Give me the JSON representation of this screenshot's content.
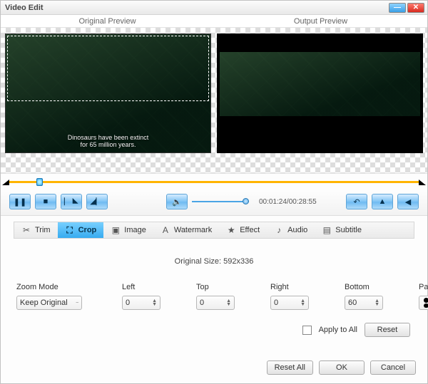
{
  "window": {
    "title": "Video Edit"
  },
  "previews": {
    "original_label": "Original Preview",
    "output_label": "Output Preview",
    "subtitle_line1": "Dinosaurs have been extinct",
    "subtitle_line2": "for 65 million years."
  },
  "timecode": "00:01:24/00:28:55",
  "tabs": [
    {
      "key": "trim",
      "label": "Trim",
      "icon": "✂"
    },
    {
      "key": "crop",
      "label": "Crop",
      "icon": "⛶"
    },
    {
      "key": "image",
      "label": "Image",
      "icon": "▣"
    },
    {
      "key": "watermark",
      "label": "Watermark",
      "icon": "A"
    },
    {
      "key": "effect",
      "label": "Effect",
      "icon": "★"
    },
    {
      "key": "audio",
      "label": "Audio",
      "icon": "♪"
    },
    {
      "key": "subtitle",
      "label": "Subtitle",
      "icon": "▤"
    }
  ],
  "crop": {
    "original_size_label": "Original Size: 592x336",
    "zoom_mode_label": "Zoom Mode",
    "zoom_mode_value": "Keep Original",
    "left_label": "Left",
    "left_value": "0",
    "top_label": "Top",
    "top_value": "0",
    "right_label": "Right",
    "right_value": "0",
    "bottom_label": "Bottom",
    "bottom_value": "60",
    "padcolor_label": "Pad Color",
    "apply_all_label": "Apply to All",
    "reset_label": "Reset"
  },
  "buttons": {
    "reset_all": "Reset All",
    "ok": "OK",
    "cancel": "Cancel"
  },
  "colors": {
    "accent": "#37abf0",
    "track": "#ffb400"
  }
}
